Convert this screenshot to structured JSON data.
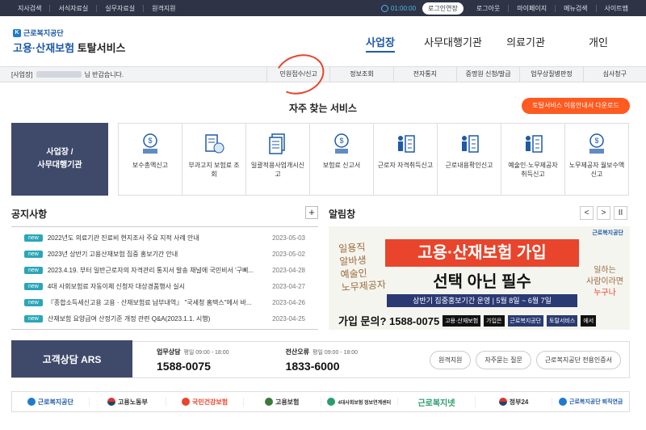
{
  "topbar": {
    "left_links": [
      "지사검색",
      "서식자료실",
      "실무자료실",
      "원격지원"
    ],
    "timer": "01:00:00",
    "extend_label": "로그인연장",
    "right_links": [
      "로그아웃",
      "마이페이지",
      "메뉴검색",
      "사이트맵"
    ]
  },
  "header": {
    "logo_top": "근로복지공단",
    "logo_main": "고용·산재보험",
    "logo_sub": "토탈서비스",
    "nav": [
      "사업장",
      "사무대행기관",
      "의료기관",
      "개인"
    ]
  },
  "subbar": {
    "greet_prefix": "[사업장]",
    "greet_suffix": "님 반갑습니다.",
    "items": [
      "민원접수/신고",
      "정보조회",
      "전자통지",
      "증명원 신청/발급",
      "업무상질병판정",
      "심사청구"
    ]
  },
  "faq": {
    "title": "자주 찾는 서비스",
    "download_label": "토탈서비스 이용안내서 다운로드",
    "side_label_1": "사업장 /",
    "side_label_2": "사무대행기관",
    "services": [
      "보수총액신고",
      "부과고지 보험료 조회",
      "일괄적용사업개시신고",
      "보험료 신고서",
      "근로자 자격취득신고",
      "근로내용확인신고",
      "예술인·노무제공자 취득신고",
      "노무제공자 월보수액 신고"
    ]
  },
  "notice": {
    "title": "공지사항",
    "plus": "+",
    "badge": "new",
    "items": [
      {
        "text": "2022년도 의료기관 진료비 현지조사 주요 지적 사례 안내",
        "date": "2023-05-03"
      },
      {
        "text": "2023년 상반기 고용산재보험 집중 홍보기간 안내",
        "date": "2023-05-02"
      },
      {
        "text": "2023.4.19. 부터 일반근로자의 자격관리 통지서 발송 채널에 국민비서 '구삐...",
        "date": "2023-04-28"
      },
      {
        "text": "4대 사회보험료 자동이체 신청자 대상경품행사 실시",
        "date": "2023-04-27"
      },
      {
        "text": "『종합소득세신고용 고용 · 산재보험료 납부내역』 \"국세청 홈택스\"에서 바...",
        "date": "2023-04-26"
      },
      {
        "text": "산재보험 요양급여 산정기준 개정 관련 Q&A(2023.1.1. 시행)",
        "date": "2023-04-25"
      }
    ]
  },
  "alarm": {
    "title": "알림창",
    "prev": "<",
    "next": ">",
    "pause": "II",
    "banner_logo": "근로복지공단",
    "left_script_1": "일용직",
    "left_script_2": "알바생",
    "left_script_3": "예술인",
    "left_script_4": "노무제공자",
    "headline": "고용·산재보험 가입",
    "subheadline": "선택 아닌 필수",
    "period": "상반기 집중홍보기간 운영 | 5월 8일 ~ 6월 7일",
    "right_script_1": "일하는",
    "right_script_2": "사람이라면",
    "right_script_3": "누구나",
    "inquiry": "가입 문의? 1588-0075",
    "tag1": "고용·산재보험",
    "tag2": "가입은",
    "tag3": "근로복지공단",
    "tag4": "토탈서비스",
    "tag5": "에서"
  },
  "ars": {
    "title": "고객상담 ARS",
    "biz_label": "업무상담",
    "biz_hours": "평일 09:00 - 18:00",
    "biz_number": "1588-0075",
    "it_label": "전산오류",
    "it_hours": "평일 09:00 - 18:00",
    "it_number": "1833-6000",
    "buttons": [
      "원격지원",
      "자주묻는 질문",
      "근로복지공단 전용인증서"
    ]
  },
  "partners": [
    "근로복지공단",
    "고용노동부",
    "국민건강보험",
    "고용보험",
    "4대사회보험 정보연계센터",
    "근로복지넷",
    "정부24",
    "근로복지공단 퇴직연금"
  ],
  "colors": {
    "topbar": "#2f3346",
    "brand": "#1f5aa8",
    "accent": "#ff5a1f",
    "badge": "#2aa6b8",
    "navy": "#3f4a6b"
  }
}
